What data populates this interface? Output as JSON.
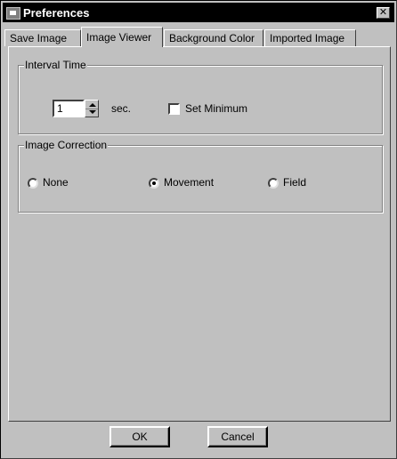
{
  "window": {
    "title": "Preferences",
    "close_label": "✕"
  },
  "tabs": [
    {
      "label": "Save Image"
    },
    {
      "label": "Image Viewer",
      "active": true
    },
    {
      "label": "Background Color"
    },
    {
      "label": "Imported Image"
    }
  ],
  "interval_group": {
    "title": "Interval Time",
    "value": "1",
    "unit": "sec.",
    "set_minimum_label": "Set Minimum",
    "set_minimum_checked": false
  },
  "correction_group": {
    "title": "Image Correction",
    "options": [
      {
        "label": "None",
        "selected": false
      },
      {
        "label": "Movement",
        "selected": true
      },
      {
        "label": "Field",
        "selected": false
      }
    ]
  },
  "buttons": {
    "ok_label": "OK",
    "cancel_label": "Cancel"
  },
  "icons": {
    "app": "window-icon",
    "close": "close-icon",
    "spin_up": "spin-up-icon",
    "spin_down": "spin-down-icon"
  }
}
